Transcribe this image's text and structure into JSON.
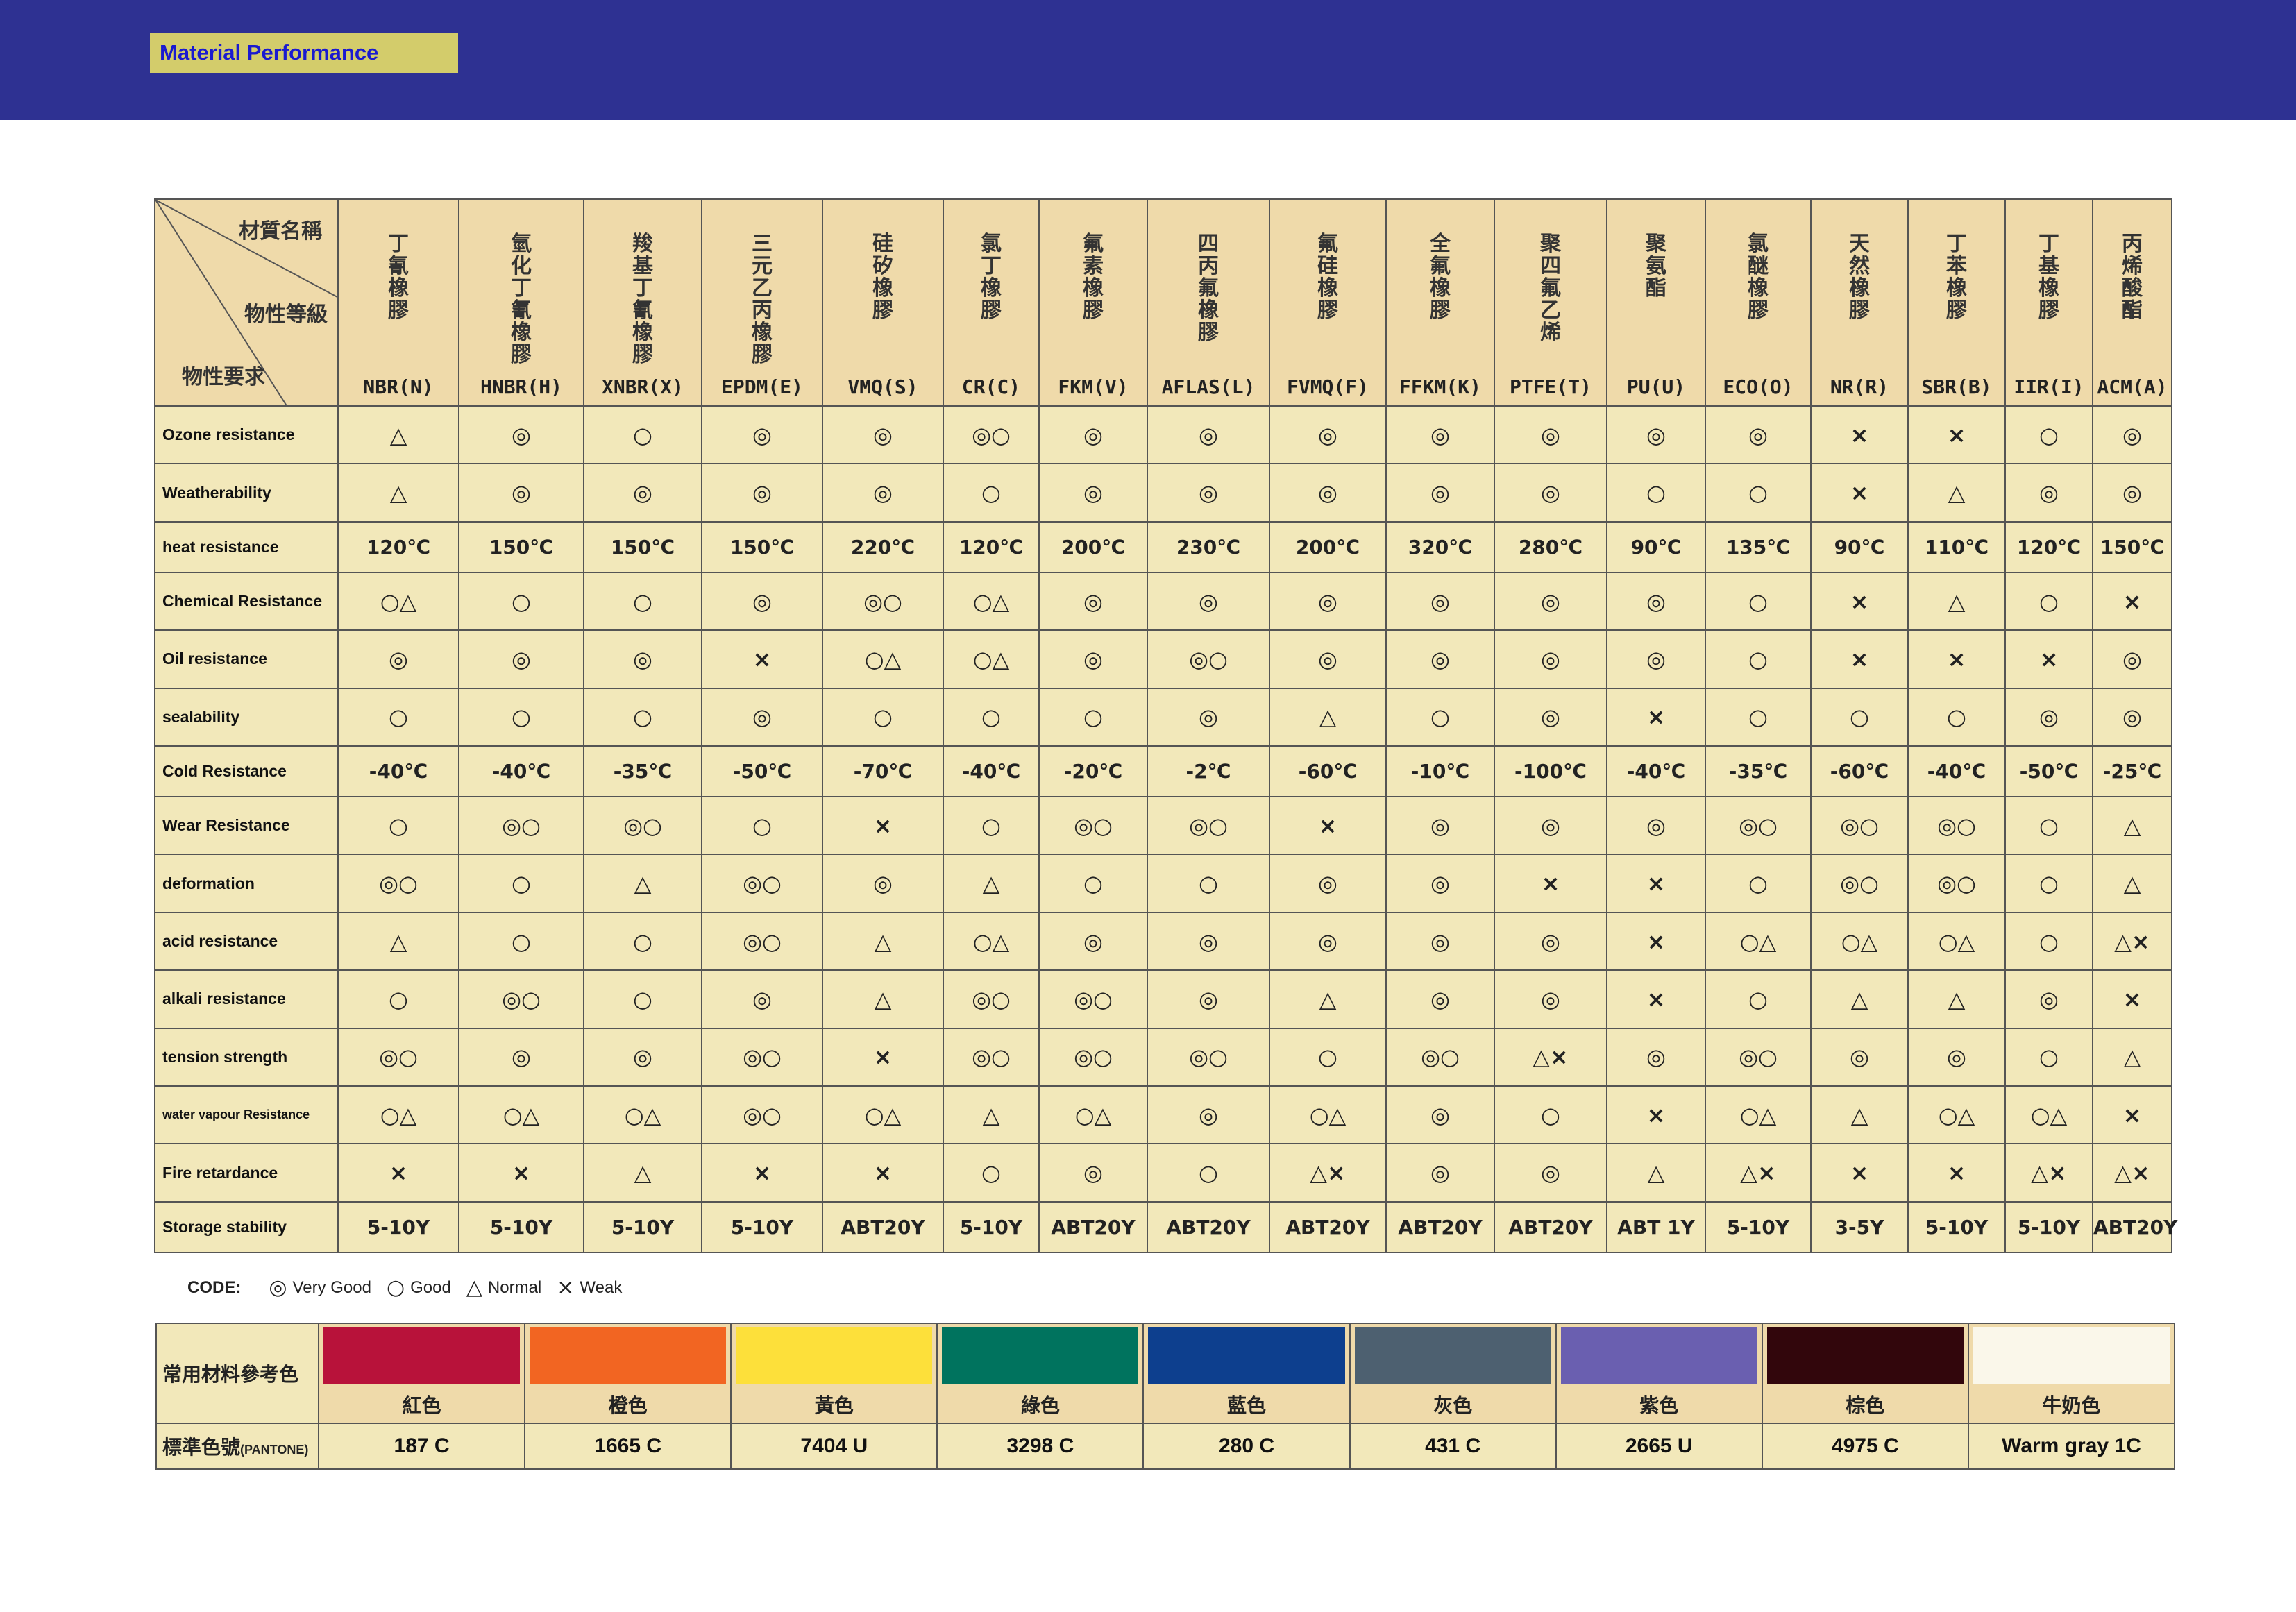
{
  "header": {
    "title": "Material Performance"
  },
  "table": {
    "corner": {
      "top": "材質名稱",
      "middle": "物性等級",
      "bottom": "物性要求"
    },
    "materials": [
      {
        "name": "丁\n氰\n橡\n膠",
        "code": "NBR(N)"
      },
      {
        "name": "氫\n化\n丁\n氰\n橡\n膠",
        "code": "HNBR(H)"
      },
      {
        "name": "羧\n基\n丁\n氰\n橡\n膠",
        "code": "XNBR(X)"
      },
      {
        "name": "三\n元\n乙\n丙\n橡\n膠",
        "code": "EPDM(E)"
      },
      {
        "name": "硅\n矽\n橡\n膠",
        "code": "VMQ(S)"
      },
      {
        "name": "氯\n丁\n橡\n膠",
        "code": "CR(C)"
      },
      {
        "name": "氟\n素\n橡\n膠",
        "code": "FKM(V)"
      },
      {
        "name": "四\n丙\n氟\n橡\n膠",
        "code": "AFLAS(L)"
      },
      {
        "name": "氟\n硅\n橡\n膠",
        "code": "FVMQ(F)"
      },
      {
        "name": "全\n氟\n橡\n膠",
        "code": "FFKM(K)"
      },
      {
        "name": "聚\n四\n氟\n乙\n烯",
        "code": "PTFE(T)"
      },
      {
        "name": "聚\n氨\n酯",
        "code": "PU(U)"
      },
      {
        "name": "氯\n醚\n橡\n膠",
        "code": "ECO(O)"
      },
      {
        "name": "天\n然\n橡\n膠",
        "code": "NR(R)"
      },
      {
        "name": "丁\n苯\n橡\n膠",
        "code": "SBR(B)"
      },
      {
        "name": "丁\n基\n橡\n膠",
        "code": "IIR(I)"
      },
      {
        "name": "丙\n烯\n酸\n酯",
        "code": "ACM(A)"
      }
    ],
    "rows": [
      {
        "label": "Ozone resistance",
        "values": [
          "△",
          "◎",
          "○",
          "◎",
          "◎",
          "◎○",
          "◎",
          "◎",
          "◎",
          "◎",
          "◎",
          "◎",
          "◎",
          "×",
          "×",
          "○",
          "◎"
        ]
      },
      {
        "label": "Weatherability",
        "values": [
          "△",
          "◎",
          "◎",
          "◎",
          "◎",
          "○",
          "◎",
          "◎",
          "◎",
          "◎",
          "◎",
          "○",
          "○",
          "×",
          "△",
          "◎",
          "◎"
        ]
      },
      {
        "label": "heat resistance",
        "values": [
          "120℃",
          "150℃",
          "150℃",
          "150℃",
          "220℃",
          "120℃",
          "200℃",
          "230℃",
          "200℃",
          "320℃",
          "280℃",
          "90℃",
          "135℃",
          "90℃",
          "110℃",
          "120℃",
          "150℃"
        ]
      },
      {
        "label": "Chemical Resistance",
        "values": [
          "○△",
          "○",
          "○",
          "◎",
          "◎○",
          "○△",
          "◎",
          "◎",
          "◎",
          "◎",
          "◎",
          "◎",
          "○",
          "×",
          "△",
          "○",
          "×"
        ]
      },
      {
        "label": "Oil resistance",
        "values": [
          "◎",
          "◎",
          "◎",
          "×",
          "○△",
          "○△",
          "◎",
          "◎○",
          "◎",
          "◎",
          "◎",
          "◎",
          "○",
          "×",
          "×",
          "×",
          "◎"
        ]
      },
      {
        "label": "sealability",
        "values": [
          "○",
          "○",
          "○",
          "◎",
          "○",
          "○",
          "○",
          "◎",
          "△",
          "○",
          "◎",
          "×",
          "○",
          "○",
          "○",
          "◎",
          "◎"
        ]
      },
      {
        "label": "Cold Resistance",
        "values": [
          "-40℃",
          "-40℃",
          "-35℃",
          "-50℃",
          "-70℃",
          "-40℃",
          "-20℃",
          "-2℃",
          "-60℃",
          "-10℃",
          "-100℃",
          "-40℃",
          "-35℃",
          "-60℃",
          "-40℃",
          "-50℃",
          "-25℃"
        ]
      },
      {
        "label": "Wear Resistance",
        "values": [
          "○",
          "◎○",
          "◎○",
          "○",
          "×",
          "○",
          "◎○",
          "◎○",
          "×",
          "◎",
          "◎",
          "◎",
          "◎○",
          "◎○",
          "◎○",
          "○",
          "△"
        ]
      },
      {
        "label": "deformation",
        "values": [
          "◎○",
          "○",
          "△",
          "◎○",
          "◎",
          "△",
          "○",
          "○",
          "◎",
          "◎",
          "×",
          "×",
          "○",
          "◎○",
          "◎○",
          "○",
          "△"
        ]
      },
      {
        "label": "acid resistance",
        "values": [
          "△",
          "○",
          "○",
          "◎○",
          "△",
          "○△",
          "◎",
          "◎",
          "◎",
          "◎",
          "◎",
          "×",
          "○△",
          "○△",
          "○△",
          "○",
          "△×"
        ]
      },
      {
        "label": "alkali resistance",
        "values": [
          "○",
          "◎○",
          "○",
          "◎",
          "△",
          "◎○",
          "◎○",
          "◎",
          "△",
          "◎",
          "◎",
          "×",
          "○",
          "△",
          "△",
          "◎",
          "×"
        ]
      },
      {
        "label": "tension strength",
        "values": [
          "◎○",
          "◎",
          "◎",
          "◎○",
          "×",
          "◎○",
          "◎○",
          "◎○",
          "○",
          "◎○",
          "△×",
          "◎",
          "◎○",
          "◎",
          "◎",
          "○",
          "△"
        ]
      },
      {
        "label": "water vapour Resistance",
        "small": true,
        "values": [
          "○△",
          "○△",
          "○△",
          "◎○",
          "○△",
          "△",
          "○△",
          "◎",
          "○△",
          "◎",
          "○",
          "×",
          "○△",
          "△",
          "○△",
          "○△",
          "×"
        ]
      },
      {
        "label": "Fire retardance",
        "values": [
          "×",
          "×",
          "△",
          "×",
          "×",
          "○",
          "◎",
          "○",
          "△×",
          "◎",
          "◎",
          "△",
          "△×",
          "×",
          "×",
          "△×",
          "△×"
        ]
      },
      {
        "label": "Storage stability",
        "values": [
          "5-10Y",
          "5-10Y",
          "5-10Y",
          "5-10Y",
          "ABT20Y",
          "5-10Y",
          "ABT20Y",
          "ABT20Y",
          "ABT20Y",
          "ABT20Y",
          "ABT20Y",
          "ABT 1Y",
          "5-10Y",
          "3-5Y",
          "5-10Y",
          "5-10Y",
          "ABT20Y"
        ]
      }
    ]
  },
  "code_legend": {
    "label": "CODE:",
    "items": [
      {
        "symbol": "◎",
        "text": "Very Good"
      },
      {
        "symbol": "○",
        "text": "Good"
      },
      {
        "symbol": "△",
        "text": "Normal"
      },
      {
        "symbol": "×",
        "text": "Weak"
      }
    ]
  },
  "colors": {
    "row1_label": "常用材料參考色",
    "row2_label": "標準色號",
    "row2_sub": "(PANTONE)",
    "swatches": [
      {
        "name": "紅色",
        "code": "187 C",
        "hex": "#b8123a"
      },
      {
        "name": "橙色",
        "code": "1665 C",
        "hex": "#f26522"
      },
      {
        "name": "黃色",
        "code": "7404 U",
        "hex": "#fde03a"
      },
      {
        "name": "綠色",
        "code": "3298 C",
        "hex": "#00735e"
      },
      {
        "name": "藍色",
        "code": "280 C",
        "hex": "#0d3f8e"
      },
      {
        "name": "灰色",
        "code": "431 C",
        "hex": "#4d6070"
      },
      {
        "name": "紫色",
        "code": "2665 U",
        "hex": "#6a5fb0"
      },
      {
        "name": "棕色",
        "code": "4975 C",
        "hex": "#32060c"
      },
      {
        "name": "牛奶色",
        "code": "Warm gray 1C",
        "hex": "#faf7ea"
      }
    ]
  },
  "style": {
    "banner": "#2e3192",
    "title_bg": "#d3cc6b",
    "title_text": "#1a1ad0"
  }
}
